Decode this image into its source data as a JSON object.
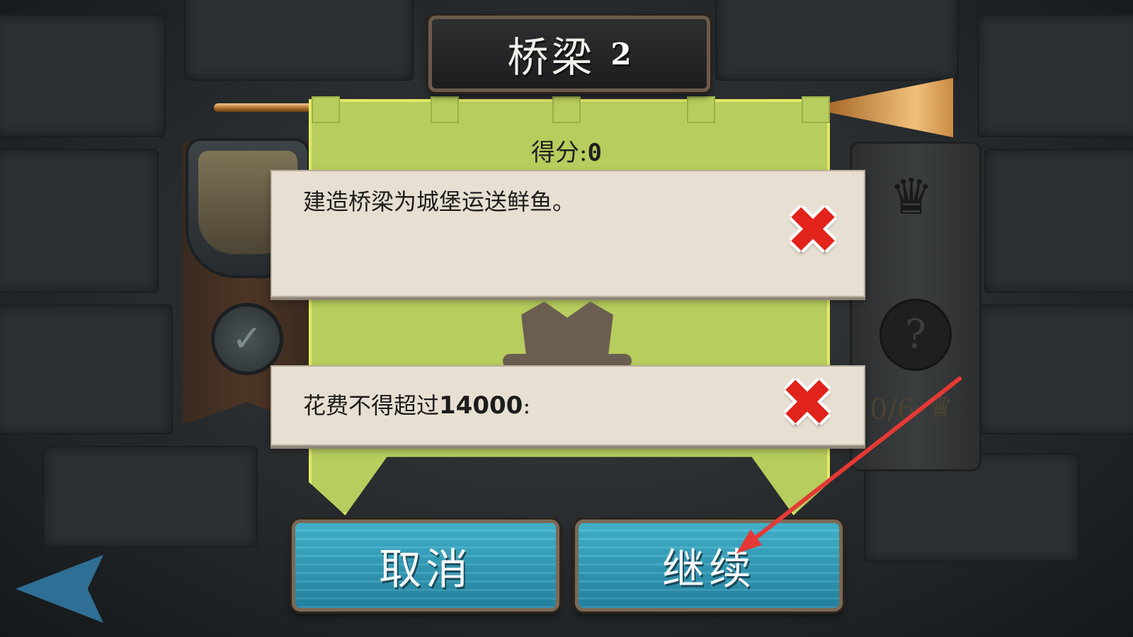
{
  "title": {
    "name": "桥梁",
    "number": "2"
  },
  "score": {
    "label": "得分:",
    "value": "0"
  },
  "objectives": [
    {
      "text": "建造桥梁为城堡运送鲜鱼。",
      "status": "failed",
      "status_icon": "red-x-icon"
    },
    {
      "text_prefix": "花费不得超过",
      "value": "14000",
      "text_suffix": ":",
      "status": "failed",
      "status_icon": "red-x-icon"
    }
  ],
  "crowns": {
    "counter": "0/6"
  },
  "buttons": {
    "cancel": "取消",
    "continue": "继续"
  },
  "icons": {
    "check": "check-icon",
    "question": "question-mark-icon",
    "crown": "crown-icon",
    "back": "back-arrow-icon",
    "trumpet": "trumpet-icon"
  },
  "colors": {
    "banner": "#b7cd5d",
    "button": "#2f9fbe",
    "fail": "#e2231b",
    "annotation": "#e53935"
  }
}
